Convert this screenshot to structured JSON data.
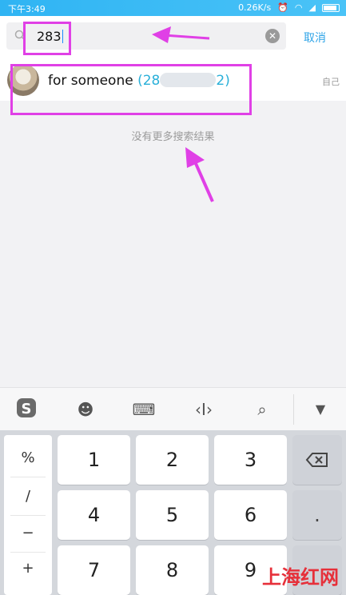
{
  "status_bar": {
    "time": "下午3:49",
    "net_speed": "0.26K/s"
  },
  "search": {
    "query": "283",
    "cancel_label": "取消",
    "clear_icon": "clear-circle-icon",
    "search_icon": "search-icon"
  },
  "result": {
    "name": "for someone",
    "number_prefix": "(28",
    "number_suffix": "2)",
    "tag": "自己"
  },
  "no_more_results": "没有更多搜索结果",
  "keyboard": {
    "toolbar_icons": [
      "sogou-logo-icon",
      "emoji-icon",
      "keyboard-icon",
      "cursor-move-icon",
      "search-icon",
      "collapse-icon"
    ],
    "symbols": [
      "%",
      "/",
      "−",
      "+"
    ],
    "digits_row1": [
      "1",
      "2",
      "3"
    ],
    "digits_row2": [
      "4",
      "5",
      "6"
    ],
    "digits_row3": [
      "7",
      "8",
      "9"
    ],
    "dot_key": "."
  },
  "watermark": "上海红网",
  "colors": {
    "status_bar": "#2fb4f3",
    "accent": "#2fa4e7",
    "highlight": "#e040e6"
  }
}
